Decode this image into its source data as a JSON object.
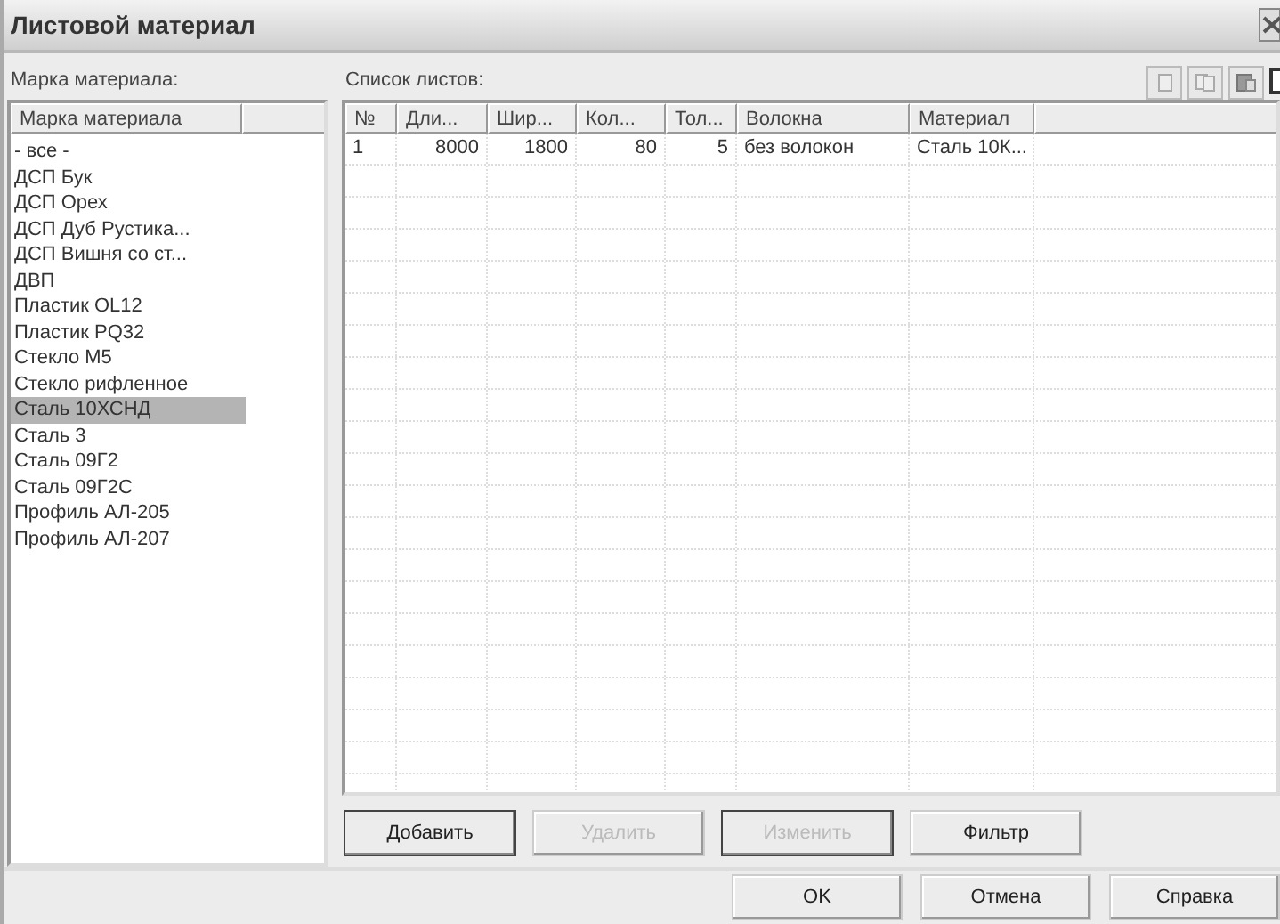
{
  "window": {
    "title": "Листовой материал"
  },
  "materials": {
    "label": "Марка материала:",
    "columns": [
      "Марка материала"
    ],
    "items": [
      {
        "name": "- все -",
        "selected": false
      },
      {
        "name": "ДСП Бук",
        "selected": false
      },
      {
        "name": "ДСП Орех",
        "selected": false
      },
      {
        "name": "ДСП Дуб Рустика...",
        "selected": false
      },
      {
        "name": "ДСП Вишня со ст...",
        "selected": false
      },
      {
        "name": "ДВП",
        "selected": false
      },
      {
        "name": "Пластик OL12",
        "selected": false
      },
      {
        "name": "Пластик PQ32",
        "selected": false
      },
      {
        "name": "Стекло М5",
        "selected": false
      },
      {
        "name": "Стекло рифленное",
        "selected": false
      },
      {
        "name": "Сталь 10ХСНД",
        "selected": true
      },
      {
        "name": "Сталь 3",
        "selected": false
      },
      {
        "name": "Сталь 09Г2",
        "selected": false
      },
      {
        "name": "Сталь 09Г2С",
        "selected": false
      },
      {
        "name": "Профиль АЛ-205",
        "selected": false
      },
      {
        "name": "Профиль АЛ-207",
        "selected": false
      }
    ]
  },
  "sheets": {
    "label": "Список листов:",
    "columns": [
      {
        "label": "№",
        "kind": "text"
      },
      {
        "label": "Дли...",
        "kind": "number"
      },
      {
        "label": "Шир...",
        "kind": "number"
      },
      {
        "label": "Кол...",
        "kind": "number"
      },
      {
        "label": "Тол...",
        "kind": "number"
      },
      {
        "label": "Волокна",
        "kind": "text"
      },
      {
        "label": "Материал",
        "kind": "text"
      }
    ],
    "rows": [
      [
        "1",
        "8000",
        "1800",
        "80",
        "5",
        "без волокон",
        "Сталь 10К..."
      ]
    ]
  },
  "buttons": [
    {
      "label": "Добавить",
      "disabled": false,
      "default": true
    },
    {
      "label": "Удалить",
      "disabled": true,
      "default": false
    },
    {
      "label": "Изменить",
      "disabled": true,
      "default": true
    },
    {
      "label": "Фильтр",
      "disabled": false,
      "default": false
    }
  ],
  "dialog_buttons": [
    {
      "label": "OK",
      "disabled": false
    },
    {
      "label": "Отмена",
      "disabled": false
    },
    {
      "label": "Справка",
      "disabled": false
    }
  ]
}
